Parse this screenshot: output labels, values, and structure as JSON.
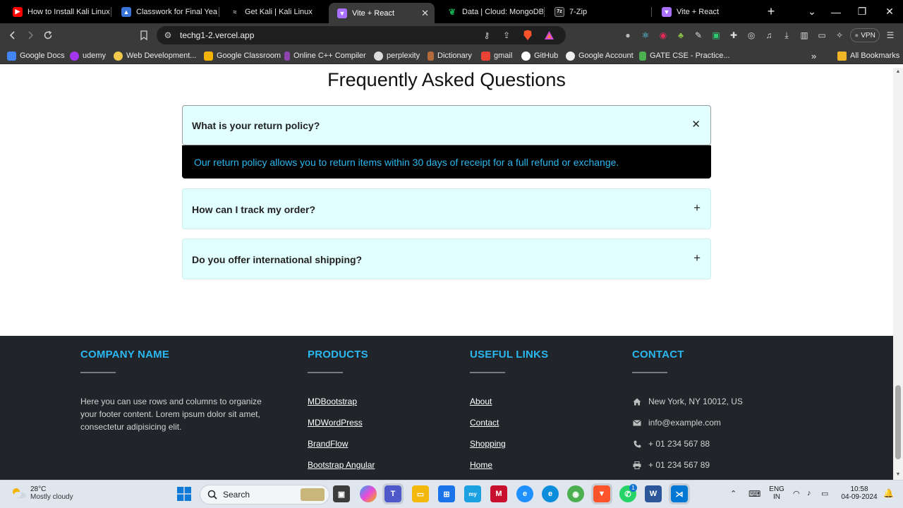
{
  "browser": {
    "tabs": [
      {
        "title": "How to Install Kali Linux i",
        "icon": "youtube-icon",
        "color": "#ff0000",
        "active": false
      },
      {
        "title": "Classwork for Final Year C",
        "icon": "classroom-icon",
        "color": "#3b74d9",
        "active": false
      },
      {
        "title": "Get Kali | Kali Linux",
        "icon": "kali-icon",
        "color": "#999999",
        "active": false
      },
      {
        "title": "Vite + React",
        "icon": "vite-icon",
        "color": "#a970ff",
        "active": true
      },
      {
        "title": "Data | Cloud: MongoDB C",
        "icon": "mongodb-icon",
        "color": "#13aa52",
        "active": false
      },
      {
        "title": "7-Zip",
        "icon": "7zip-icon",
        "color": "#444444",
        "active": false
      },
      {
        "title": "Vite + React",
        "icon": "vite-icon",
        "color": "#a970ff",
        "active": false
      }
    ],
    "new_tab": "+",
    "tab_list": "⌄",
    "window": {
      "minimize": "—",
      "maximize": "❐",
      "close": "✕"
    },
    "url": "techg1-2.vercel.app",
    "vpn_label": "VPN",
    "bookmarks": [
      {
        "label": "Google Docs",
        "color": "#4285f4"
      },
      {
        "label": "udemy",
        "color": "#a435f0"
      },
      {
        "label": "Web Development...",
        "color": "#f2c94c"
      },
      {
        "label": "Google Classroom",
        "color": "#f4b400"
      },
      {
        "label": "Online C++ Compiler",
        "color": "#8e44ad"
      },
      {
        "label": "perplexity",
        "color": "#dddddd"
      },
      {
        "label": "Dictionary",
        "color": "#b36b3a"
      },
      {
        "label": "gmail",
        "color": "#ea4335"
      },
      {
        "label": "GitHub",
        "color": "#ffffff"
      },
      {
        "label": "Google Account",
        "color": "#eeeeee"
      },
      {
        "label": "GATE CSE - Practice...",
        "color": "#4caf50"
      }
    ],
    "bookmarks_more": "»",
    "all_bookmarks": "All Bookmarks"
  },
  "faq": {
    "title": "Frequently Asked Questions",
    "items": [
      {
        "question": "What is your return policy?",
        "toggle": "✕",
        "answer": "Our return policy allows you to return items within 30 days of receipt for a full refund or exchange."
      },
      {
        "question": "How can I track my order?",
        "toggle": "+"
      },
      {
        "question": "Do you offer international shipping?",
        "toggle": "+"
      }
    ]
  },
  "footer": {
    "company": {
      "heading": "COMPANY NAME",
      "text": "Here you can use rows and columns to organize your footer content. Lorem ipsum dolor sit amet, consectetur adipisicing elit."
    },
    "products": {
      "heading": "PRODUCTS",
      "links": [
        "MDBootstrap",
        "MDWordPress",
        "BrandFlow",
        "Bootstrap Angular"
      ]
    },
    "useful_links": {
      "heading": "USEFUL LINKS",
      "links": [
        "About",
        "Contact",
        "Shopping",
        "Home"
      ]
    },
    "contact": {
      "heading": "CONTACT",
      "items": [
        {
          "text": "New York, NY 10012, US",
          "icon": "home-icon"
        },
        {
          "text": "info@example.com",
          "icon": "envelope-icon"
        },
        {
          "text": "+ 01 234 567 88",
          "icon": "phone-icon"
        },
        {
          "text": "+ 01 234 567 89",
          "icon": "print-icon"
        }
      ]
    }
  },
  "taskbar": {
    "weather_temp": "28°C",
    "weather_desc": "Mostly cloudy",
    "search_label": "Search",
    "lang_top": "ENG",
    "lang_bottom": "IN",
    "time": "10:58",
    "date": "04-09-2024",
    "teams_badge": "",
    "chrome_badge": "",
    "whatsapp_badge": "1"
  }
}
